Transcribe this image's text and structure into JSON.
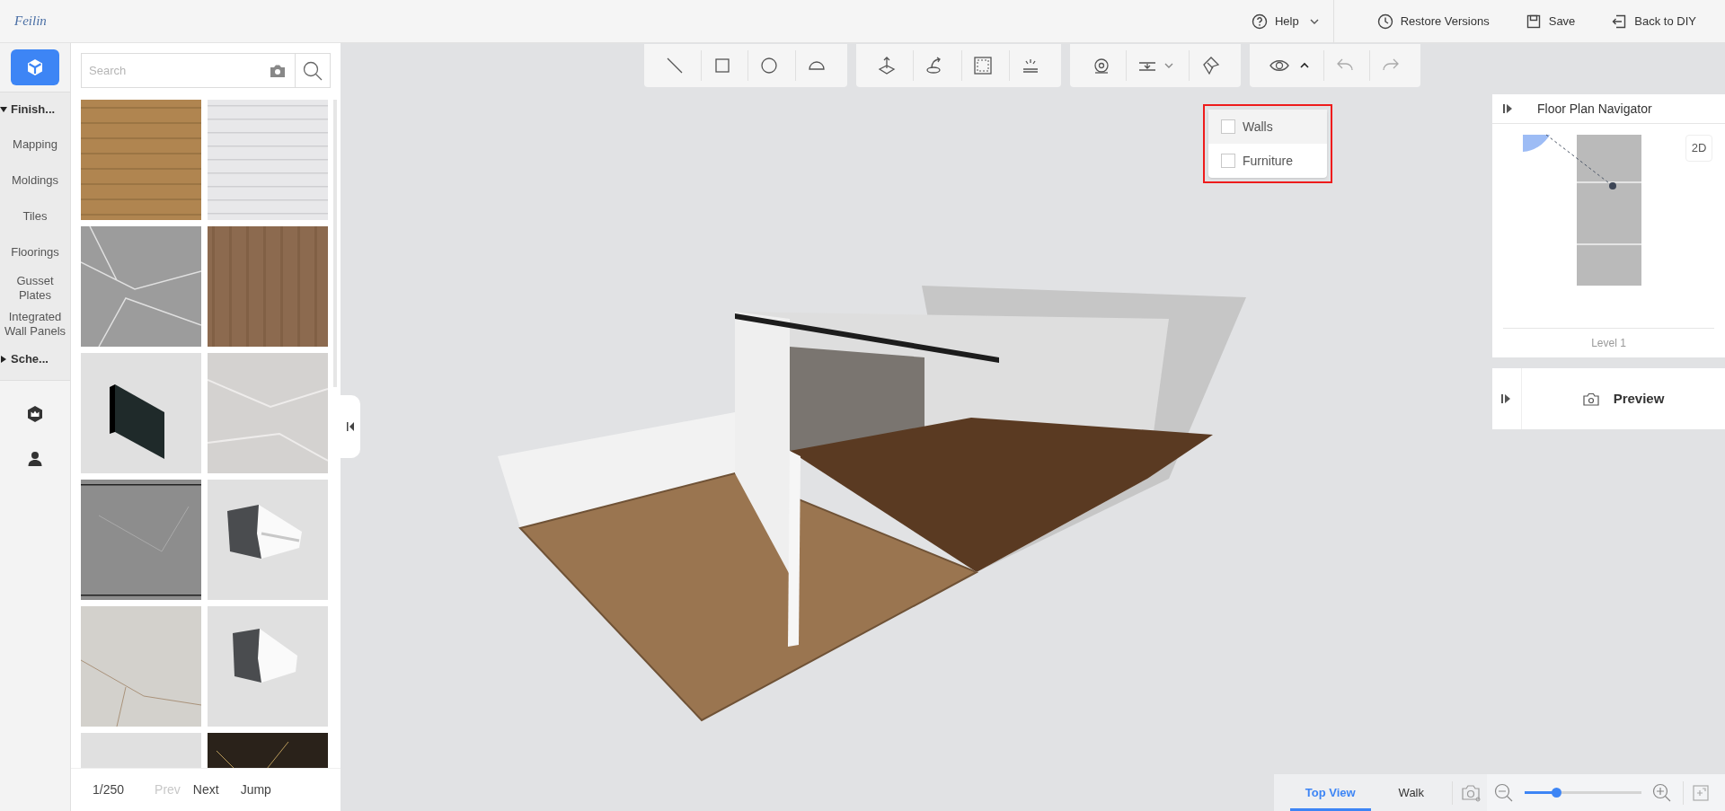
{
  "header": {
    "logo": "Feilin",
    "actions": [
      {
        "kind": "help",
        "label": "Help"
      },
      {
        "kind": "restore",
        "label": "Restore Versions"
      },
      {
        "kind": "save",
        "label": "Save"
      },
      {
        "kind": "back",
        "label": "Back to DIY"
      }
    ]
  },
  "nav": {
    "buttons": [
      {
        "kind": "materials",
        "selected": true
      },
      {
        "kind": "models",
        "selected": false
      },
      {
        "kind": "account",
        "selected": false
      }
    ],
    "categories": [
      {
        "label": "Finish...",
        "expanded": true,
        "children": [
          {
            "label": "Mapping"
          },
          {
            "label": "Moldings"
          },
          {
            "label": "Tiles"
          },
          {
            "label": "Floorings"
          },
          {
            "label": "Gusset Plates"
          },
          {
            "label": "Integrated Wall Panels"
          }
        ]
      },
      {
        "label": "Sche...",
        "expanded": false
      }
    ]
  },
  "library": {
    "search": {
      "placeholder": "Search"
    },
    "pagination": {
      "page": "1/250",
      "prev": {
        "label": "Prev",
        "disabled": true
      },
      "next": {
        "label": "Next",
        "disabled": false
      },
      "jump": "Jump"
    }
  },
  "visibility_menu": {
    "items": [
      {
        "label": "Walls",
        "checked": false
      },
      {
        "label": "Furniture",
        "checked": false
      }
    ]
  },
  "navigator": {
    "title": "Floor Plan Navigator",
    "mode": "2D",
    "level": "Level 1"
  },
  "preview": {
    "label": "Preview"
  },
  "view_tabs": [
    {
      "label": "Top View",
      "selected": true
    },
    {
      "label": "Walk",
      "selected": false
    }
  ],
  "zoom": {
    "level": 0.27
  }
}
